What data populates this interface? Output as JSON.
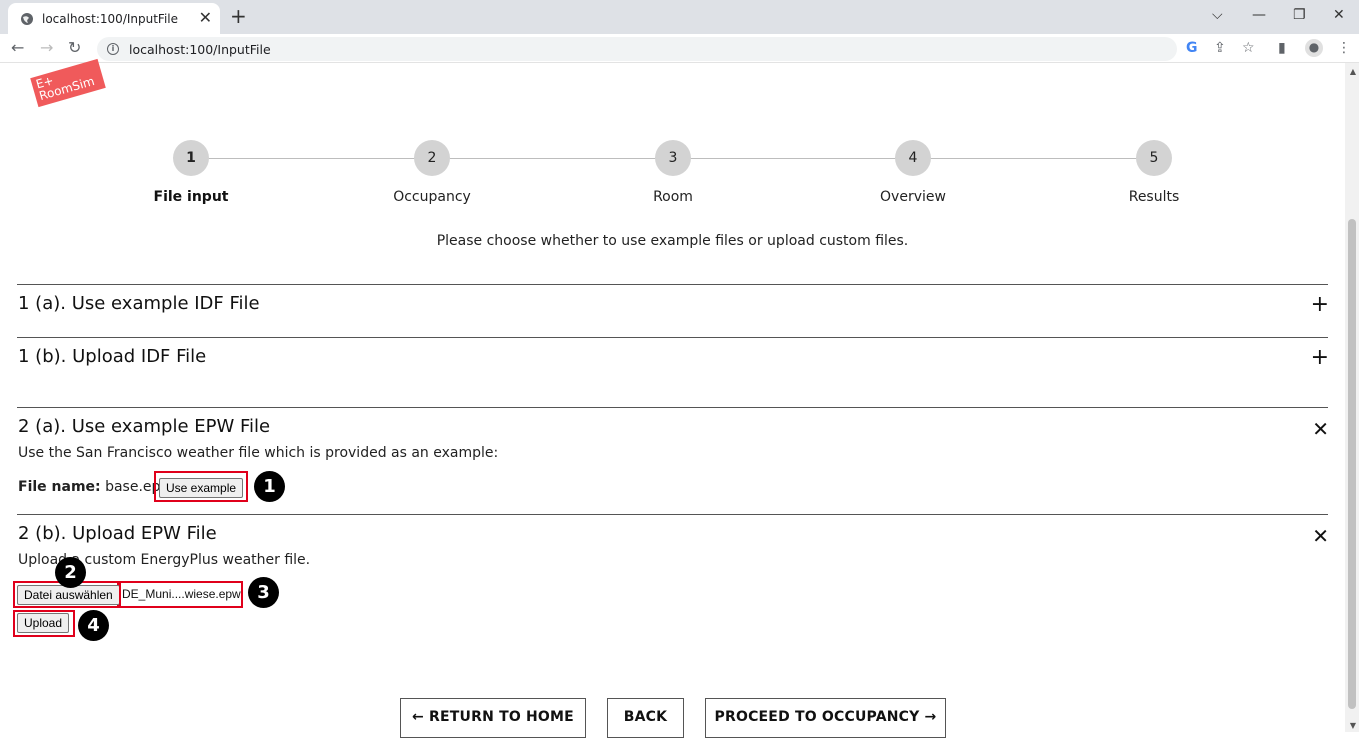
{
  "browser": {
    "tab_title": "localhost:100/InputFile",
    "url": "localhost:100/InputFile",
    "new_tab": "+",
    "tab_close": "✕"
  },
  "logo": {
    "line1": "E+",
    "line2": "RoomSim"
  },
  "stepper": {
    "steps": [
      {
        "number": "1",
        "label": "File input",
        "active": true
      },
      {
        "number": "2",
        "label": "Occupancy",
        "active": false
      },
      {
        "number": "3",
        "label": "Room",
        "active": false
      },
      {
        "number": "4",
        "label": "Overview",
        "active": false
      },
      {
        "number": "5",
        "label": "Results",
        "active": false
      }
    ]
  },
  "instruction": "Please choose whether to use example files or upload custom files.",
  "sections": {
    "idf_example": {
      "title": "1 (a). Use example IDF File",
      "toggle": "+"
    },
    "idf_upload": {
      "title": "1 (b). Upload IDF File",
      "toggle": "+"
    },
    "epw_example": {
      "title": "2 (a). Use example EPW File",
      "toggle": "✕",
      "description": "Use the San Francisco weather file which is provided as an example:",
      "file_name_label": "File name:",
      "file_name_value": "base.epw",
      "button": "Use example"
    },
    "epw_upload": {
      "title": "2 (b). Upload EPW File",
      "toggle": "✕",
      "description": "Upload a custom EnergyPlus weather file.",
      "choose_button": "Datei auswählen",
      "selected_file": "DE_Muni....wiese.epw",
      "upload_button": "Upload"
    }
  },
  "badges": [
    "1",
    "2",
    "3",
    "4"
  ],
  "footer": {
    "return_home": "← RETURN TO HOME",
    "back": "BACK",
    "proceed": "PROCEED TO OCCUPANCY →"
  },
  "colors": {
    "highlight": "#e0001b",
    "logo": "#f05a5b",
    "step_circle": "#d3d3d3"
  }
}
